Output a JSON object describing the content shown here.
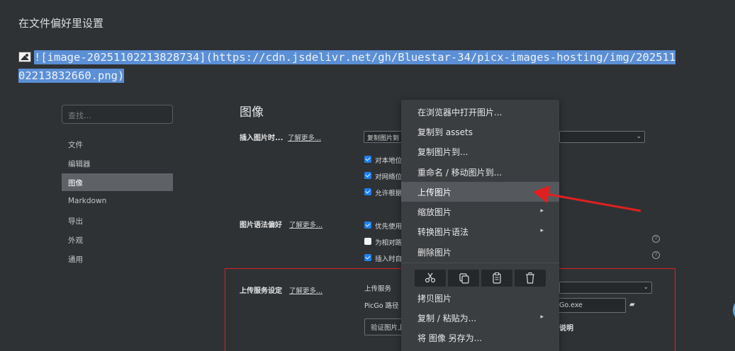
{
  "doc": {
    "heading": "在文件偏好里设置",
    "markdown_line1": "![image-20251102213828734](https://cdn.jsdelivr.net/gh/Bluestar-34/picx-images-hosting/img/202511",
    "markdown_line2": "02213832660.png)"
  },
  "sidebar": {
    "search_placeholder": "查找...",
    "items": [
      {
        "label": "文件"
      },
      {
        "label": "编辑器"
      },
      {
        "label": "图像"
      },
      {
        "label": "Markdown"
      },
      {
        "label": "导出"
      },
      {
        "label": "外观"
      },
      {
        "label": "通用"
      }
    ]
  },
  "settings": {
    "title": "图像",
    "learn_more": "了解更多...",
    "insert": {
      "label": "插入图片时...",
      "select_value": "复制图片到",
      "checkboxes": [
        {
          "text": "对本地位",
          "checked": true
        },
        {
          "text": "对网络位",
          "checked": true
        },
        {
          "text": "允许根据",
          "checked": true
        }
      ]
    },
    "syntax": {
      "label": "图片语法偏好",
      "checkboxes": [
        {
          "text": "优先使用",
          "checked": true
        },
        {
          "text": "为相对路",
          "checked": false
        },
        {
          "text": "插入时自",
          "checked": true
        }
      ]
    },
    "upload": {
      "label": "上传服务设定",
      "service_label": "上传服务",
      "picgo_label": "PicGo 路径",
      "picgo_value": "Go.exe",
      "verify_button": "验证图片上",
      "doc_link": "说明"
    }
  },
  "context_menu": {
    "items": [
      {
        "label": "在浏览器中打开图片..."
      },
      {
        "label": "复制到 assets"
      },
      {
        "label": "复制图片到..."
      },
      {
        "label": "重命名 / 移动图片到..."
      },
      {
        "label": "上传图片"
      },
      {
        "label": "缩放图片"
      },
      {
        "label": "转换图片语法"
      },
      {
        "label": "删除图片"
      }
    ],
    "items_bottom": [
      {
        "label": "拷贝图片"
      },
      {
        "label": "复制 / 粘贴为..."
      },
      {
        "label": "将 图像 另存为..."
      }
    ],
    "submenu_arrow": "▸",
    "icons": [
      "scissors-icon",
      "copy-icon",
      "clipboard-icon",
      "trash-icon"
    ]
  },
  "colors": {
    "selection": "#5b8fd6",
    "highlight": "#55595e",
    "annotation_red": "#d62424",
    "checkbox_blue": "#1f7ff0"
  }
}
